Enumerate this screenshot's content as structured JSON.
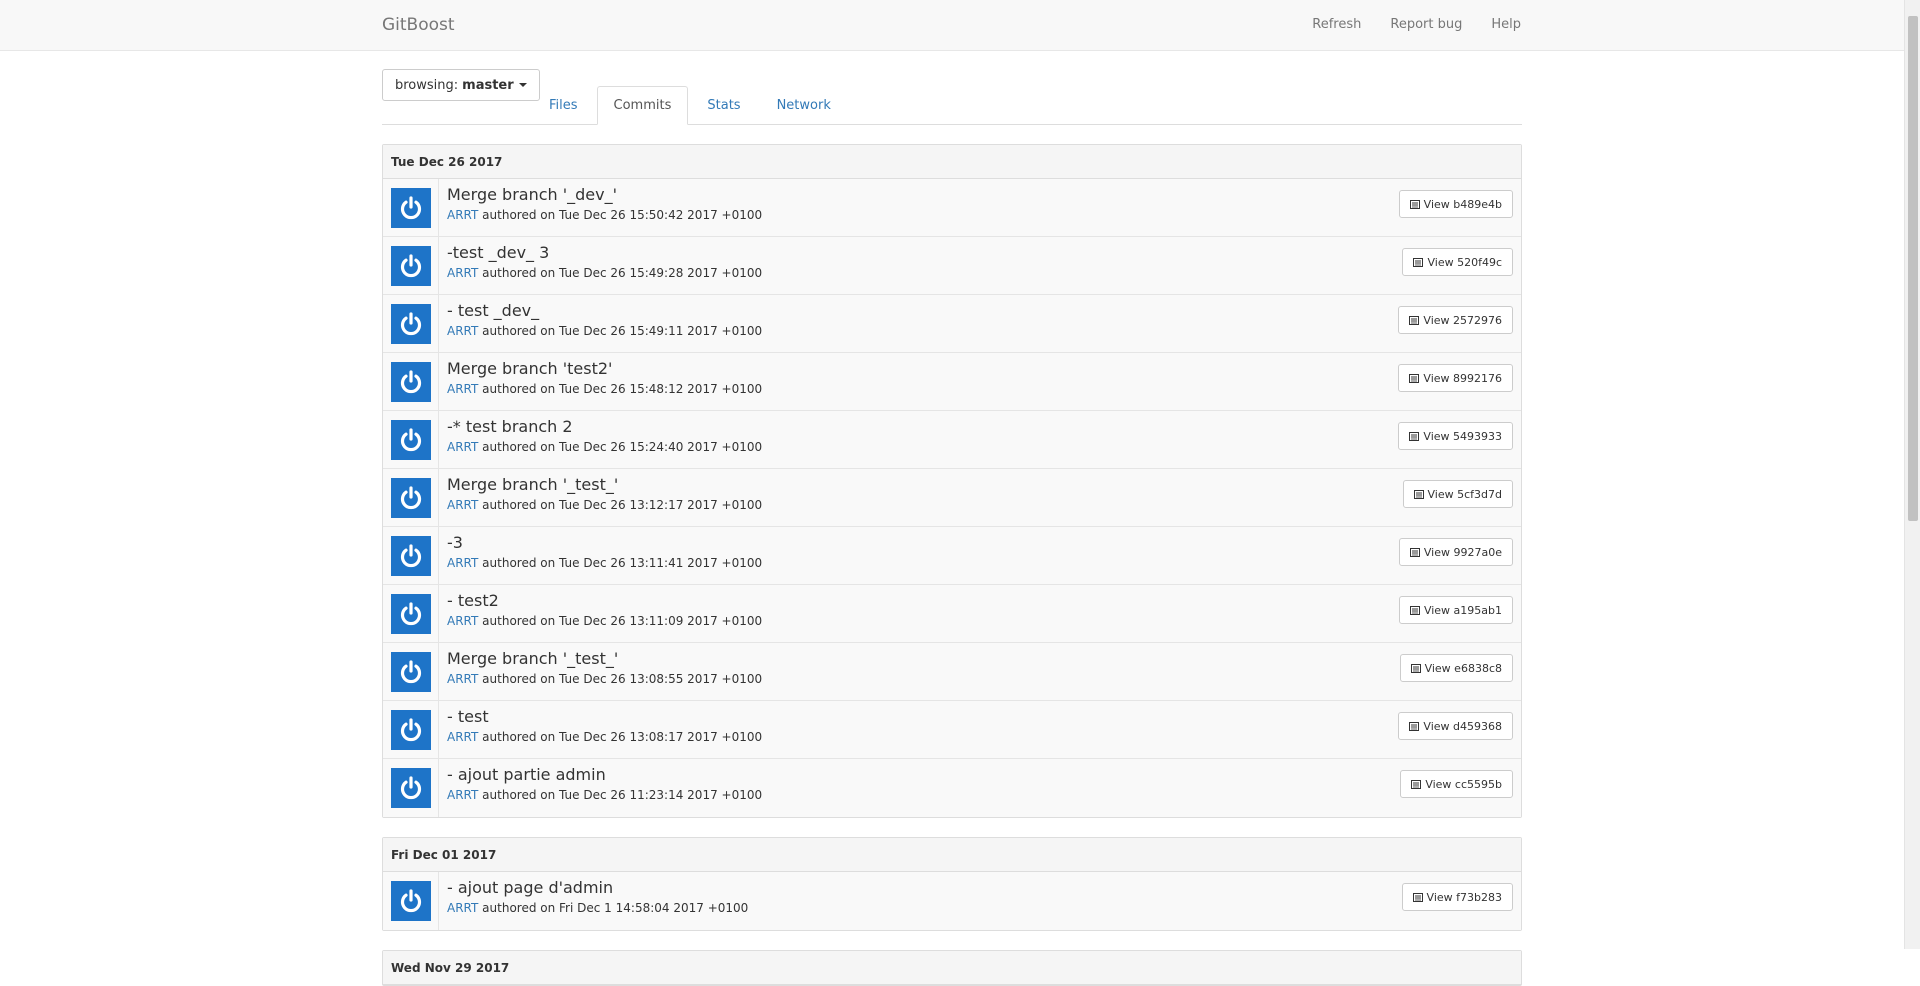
{
  "navbar": {
    "brand": "GitBoost",
    "links": [
      "Refresh",
      "Report bug",
      "Help"
    ]
  },
  "toolbar": {
    "branch_prefix": "browsing:",
    "branch_name": "master",
    "tabs": [
      "Files",
      "Commits",
      "Stats",
      "Network"
    ],
    "active_tab": "Commits"
  },
  "colors": {
    "avatar": "#1e74c8",
    "link": "#337ab7"
  },
  "icons": {
    "avatar": "power-icon",
    "view": "list-icon",
    "caret": "caret-down-icon"
  },
  "view_prefix": "View",
  "authored_text": "authored on",
  "days": [
    {
      "date": "Tue Dec 26 2017",
      "commits": [
        {
          "message": "Merge branch '_dev_'",
          "author": "ARRT",
          "date": "Tue Dec 26 15:50:42 2017 +0100",
          "hash": "b489e4b"
        },
        {
          "message": "-test _dev_ 3",
          "author": "ARRT",
          "date": "Tue Dec 26 15:49:28 2017 +0100",
          "hash": "520f49c"
        },
        {
          "message": "- test _dev_",
          "author": "ARRT",
          "date": "Tue Dec 26 15:49:11 2017 +0100",
          "hash": "2572976"
        },
        {
          "message": "Merge branch 'test2'",
          "author": "ARRT",
          "date": "Tue Dec 26 15:48:12 2017 +0100",
          "hash": "8992176"
        },
        {
          "message": "-* test branch 2",
          "author": "ARRT",
          "date": "Tue Dec 26 15:24:40 2017 +0100",
          "hash": "5493933"
        },
        {
          "message": "Merge branch '_test_'",
          "author": "ARRT",
          "date": "Tue Dec 26 13:12:17 2017 +0100",
          "hash": "5cf3d7d"
        },
        {
          "message": "-3",
          "author": "ARRT",
          "date": "Tue Dec 26 13:11:41 2017 +0100",
          "hash": "9927a0e"
        },
        {
          "message": "- test2",
          "author": "ARRT",
          "date": "Tue Dec 26 13:11:09 2017 +0100",
          "hash": "a195ab1"
        },
        {
          "message": "Merge branch '_test_'",
          "author": "ARRT",
          "date": "Tue Dec 26 13:08:55 2017 +0100",
          "hash": "e6838c8"
        },
        {
          "message": "- test",
          "author": "ARRT",
          "date": "Tue Dec 26 13:08:17 2017 +0100",
          "hash": "d459368"
        },
        {
          "message": "- ajout partie admin",
          "author": "ARRT",
          "date": "Tue Dec 26 11:23:14 2017 +0100",
          "hash": "cc5595b"
        }
      ]
    },
    {
      "date": "Fri Dec 01 2017",
      "commits": [
        {
          "message": "- ajout page d'admin",
          "author": "ARRT",
          "date": "Fri Dec 1 14:58:04 2017 +0100",
          "hash": "f73b283"
        }
      ]
    },
    {
      "date": "Wed Nov 29 2017",
      "commits": []
    }
  ]
}
